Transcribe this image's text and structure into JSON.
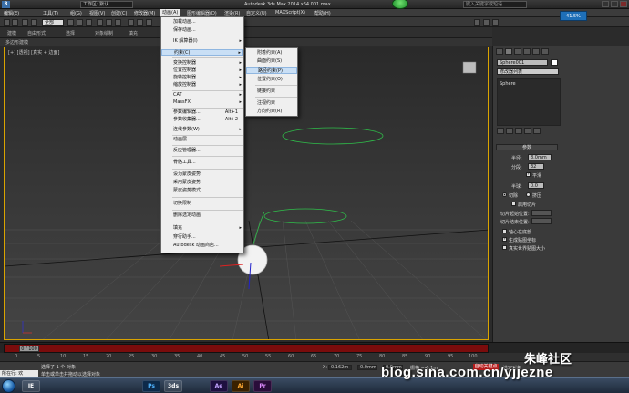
{
  "window": {
    "title": "Autodesk 3ds Max 2014 x64      001.max",
    "workspace": "工作区: 默认",
    "help_placeholder": "键入关键字或短语"
  },
  "menubar": {
    "items": [
      "编辑(E)",
      "工具(T)",
      "组(G)",
      "视图(V)",
      "创建(C)",
      "修改器(M)",
      "动画(A)",
      "图形编辑器(D)",
      "渲染(R)",
      "自定义(U)",
      "MAXScript(X)",
      "帮助(H)"
    ],
    "active_index": 6
  },
  "ribbon": {
    "tabs": [
      "建模",
      "自由形式",
      "选择",
      "对象绘制",
      "填充"
    ],
    "subtitle": "多边形建模"
  },
  "viewport": {
    "label": "[+] [透视] [真实 + 边面]"
  },
  "animation_menu": {
    "items": [
      {
        "label": "加载动画...",
        "shortcut": "",
        "submenu": false
      },
      {
        "label": "保存动画...",
        "shortcut": "",
        "submenu": false
      },
      {
        "label": "IK 解算器(I)",
        "shortcut": "",
        "submenu": true
      },
      {
        "label": "约束(C)",
        "shortcut": "",
        "submenu": true
      },
      {
        "label": "变换控制器",
        "shortcut": "",
        "submenu": true
      },
      {
        "label": "位置控制器",
        "shortcut": "",
        "submenu": true
      },
      {
        "label": "旋转控制器",
        "shortcut": "",
        "submenu": true
      },
      {
        "label": "缩放控制器",
        "shortcut": "",
        "submenu": true
      },
      {
        "label": "CAT",
        "shortcut": "",
        "submenu": true
      },
      {
        "label": "MassFX",
        "shortcut": "",
        "submenu": true
      },
      {
        "label": "参数编辑器...",
        "shortcut": "Alt+1",
        "submenu": false
      },
      {
        "label": "参数收集器...",
        "shortcut": "Alt+2",
        "submenu": false
      },
      {
        "label": "连线参数(W)",
        "shortcut": "",
        "submenu": true
      },
      {
        "label": "动画层...",
        "shortcut": "",
        "submenu": false
      },
      {
        "label": "反应管理器...",
        "shortcut": "",
        "submenu": false
      },
      {
        "label": "骨骼工具...",
        "shortcut": "",
        "submenu": false
      },
      {
        "label": "设为蒙皮姿势",
        "shortcut": "",
        "submenu": false
      },
      {
        "label": "采用蒙皮姿势",
        "shortcut": "",
        "submenu": false
      },
      {
        "label": "蒙皮姿势模式",
        "shortcut": "",
        "submenu": false
      },
      {
        "label": "切换限制",
        "shortcut": "",
        "submenu": false
      },
      {
        "label": "删除选定动画",
        "shortcut": "",
        "submenu": false
      },
      {
        "label": "填充",
        "shortcut": "",
        "submenu": true
      },
      {
        "label": "穿行助手...",
        "shortcut": "",
        "submenu": false
      },
      {
        "label": "Autodesk 动画商店...",
        "shortcut": "",
        "submenu": false
      }
    ],
    "highlighted_index": 3
  },
  "constraint_submenu": {
    "items": [
      "附着约束(A)",
      "曲面约束(S)",
      "路径约束(P)",
      "位置约束(O)",
      "链接约束",
      "注视约束",
      "方向约束(R)"
    ],
    "highlighted_index": 2
  },
  "command_panel": {
    "object_name": "Sphere001",
    "modifier_list": "修改器列表",
    "stack_item": "Sphere",
    "rollout_title": "参数",
    "radius_label": "半径:",
    "radius_value": "8.0mm",
    "segments_label": "分段:",
    "segments_value": "32",
    "smooth_label": "平滑",
    "hemisphere_label": "半球:",
    "hemisphere_value": "0.0",
    "chop_label": "切除",
    "squash_label": "挤压",
    "slice_from_label": "切片起始位置:",
    "slice_to_label": "切片结束位置:",
    "slice_on_label": "启用切片",
    "pivot_label": "轴心在底部",
    "mapping_label": "生成贴图坐标",
    "real_world_label": "真实世界贴图大小",
    "percent_badge": "41.5%"
  },
  "timeline": {
    "frame_display": "0 / 100",
    "ticks": [
      "0",
      "5",
      "10",
      "15",
      "20",
      "25",
      "30",
      "35",
      "40",
      "45",
      "50",
      "55",
      "60",
      "65",
      "70",
      "75",
      "80",
      "85",
      "90",
      "95",
      "100"
    ]
  },
  "status": {
    "line1": "选择了 1 个 对象",
    "line2": "单击或单击并拖动以选择对象",
    "left_tag": "所在行: 欢",
    "x_label": "X:",
    "x_value": "0.162m",
    "y_value": "0.0mm",
    "z_value": "0.0mm",
    "grid": "栅格 = 0.1m",
    "autokey": "自动关键点",
    "selected": "选定对象"
  },
  "watermark": {
    "text1": "blog.sina.com.cn/yjjezne",
    "text2": "朱峰社区"
  },
  "taskbar": {
    "apps": [
      "IE",
      "Ps",
      "3ds",
      "Ae",
      "Ai",
      "Pr"
    ]
  }
}
